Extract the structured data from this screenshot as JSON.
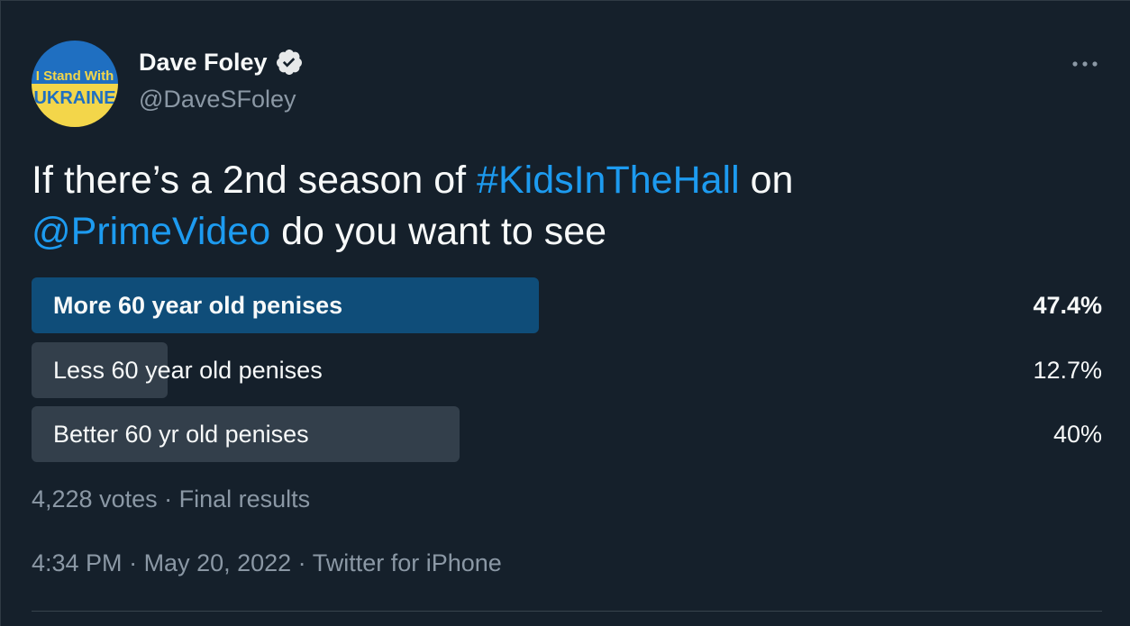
{
  "author": {
    "name": "Dave Foley",
    "handle": "@DaveSFoley",
    "avatar_text_top": "I Stand With",
    "avatar_text_bottom": "UKRAINE",
    "verified_icon": "verified-badge-icon"
  },
  "more_icon": "more-horizontal-icon",
  "tweet": {
    "text_1": "If there’s a 2nd season of ",
    "hashtag": "#KidsInTheHall",
    "text_2": " on",
    "mention": "@PrimeVideo",
    "text_3": " do you want to see"
  },
  "poll": {
    "options": [
      {
        "label": "More 60 year old penises",
        "percent": "47.4%",
        "fraction": 0.474,
        "winner": true
      },
      {
        "label": "Less 60 year old penises",
        "percent": "12.7%",
        "fraction": 0.127,
        "winner": false
      },
      {
        "label": "Better 60 yr old penises",
        "percent": "40%",
        "fraction": 0.4,
        "winner": false
      }
    ],
    "votes": "4,228 votes",
    "separator": " · ",
    "status": "Final results"
  },
  "timestamp": {
    "time": "4:34 PM",
    "date": "May 20, 2022",
    "source": "Twitter for iPhone",
    "separator": " · "
  },
  "colors": {
    "background": "#15202b",
    "link": "#1d9bf0",
    "winner_bar": "#0f4d79",
    "bar": "#333f4b",
    "secondary_text": "#8b98a5"
  }
}
